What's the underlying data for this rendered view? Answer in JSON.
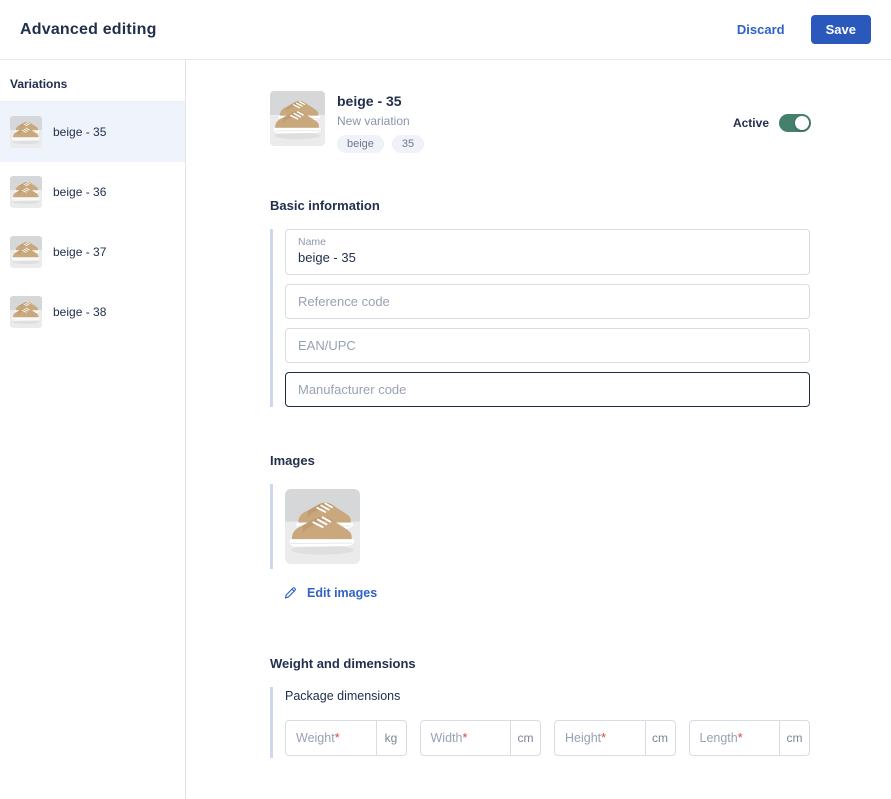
{
  "header": {
    "title": "Advanced editing",
    "discard_label": "Discard",
    "save_label": "Save"
  },
  "sidebar": {
    "title": "Variations",
    "items": [
      {
        "label": "beige - 35",
        "selected": true
      },
      {
        "label": "beige - 36",
        "selected": false
      },
      {
        "label": "beige - 37",
        "selected": false
      },
      {
        "label": "beige - 38",
        "selected": false
      }
    ]
  },
  "product": {
    "name": "beige - 35",
    "subtitle": "New variation",
    "tags": [
      "beige",
      "35"
    ],
    "active_label": "Active",
    "active_state": "on"
  },
  "basic_information": {
    "heading": "Basic information",
    "name_field": {
      "label": "Name",
      "value": "beige - 35"
    },
    "reference_code": {
      "placeholder": "Reference code",
      "value": ""
    },
    "ean_upc": {
      "placeholder": "EAN/UPC",
      "value": ""
    },
    "manufacturer_code": {
      "placeholder": "Manufacturer code",
      "value": "",
      "focused": true
    }
  },
  "images": {
    "heading": "Images",
    "edit_label": "Edit images"
  },
  "dimensions": {
    "heading": "Weight and dimensions",
    "group_label": "Package dimensions",
    "required_marker": "*",
    "fields": [
      {
        "placeholder": "Weight",
        "unit": "kg",
        "value": ""
      },
      {
        "placeholder": "Width",
        "unit": "cm",
        "value": ""
      },
      {
        "placeholder": "Height",
        "unit": "cm",
        "value": ""
      },
      {
        "placeholder": "Length",
        "unit": "cm",
        "value": ""
      }
    ]
  },
  "colors": {
    "primary_blue": "#2b58bb",
    "link_blue": "#2f62c4",
    "toggle_green": "#44806b",
    "accent_line": "#ccd8ee",
    "selected_row_bg": "#eff3fb",
    "heading_text": "#22304d",
    "placeholder_text": "#98a2b3",
    "required_red": "#d64541",
    "border": "#d9dce2",
    "focused_border": "#1f2c42"
  },
  "icons": {
    "pencil": "edit-pencil-icon",
    "shoe_thumb": "beige-sneaker-photo"
  }
}
